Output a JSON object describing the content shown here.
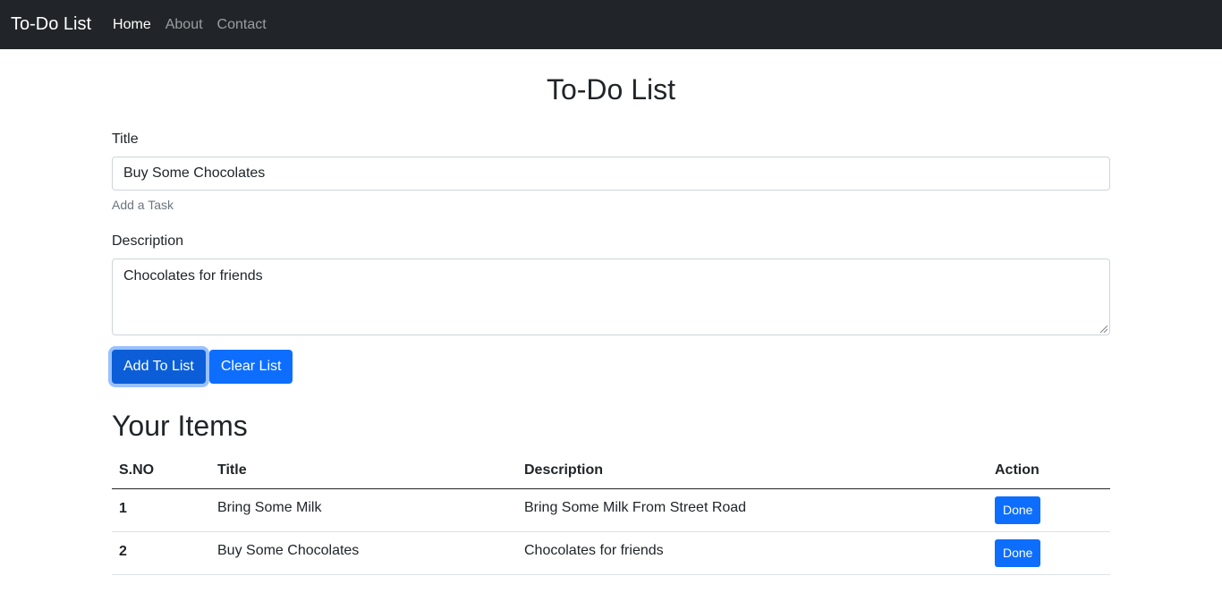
{
  "navbar": {
    "brand": "To-Do List",
    "links": [
      "Home",
      "About",
      "Contact"
    ]
  },
  "main": {
    "title": "To-Do List",
    "form": {
      "title_label": "Title",
      "title_value": "Buy Some Chocolates",
      "title_help": "Add a Task",
      "description_label": "Description",
      "description_value": "Chocolates for friends",
      "add_button": "Add To List",
      "clear_button": "Clear List"
    },
    "items_heading": "Your Items",
    "table": {
      "headers": [
        "S.NO",
        "Title",
        "Description",
        "Action"
      ],
      "rows": [
        {
          "sno": "1",
          "title": "Bring Some Milk",
          "description": "Bring Some Milk From Street Road",
          "action": "Done"
        },
        {
          "sno": "2",
          "title": "Buy Some Chocolates",
          "description": "Chocolates for friends",
          "action": "Done"
        }
      ]
    }
  },
  "colors": {
    "navbar_bg": "#212529",
    "primary": "#0d6efd"
  }
}
